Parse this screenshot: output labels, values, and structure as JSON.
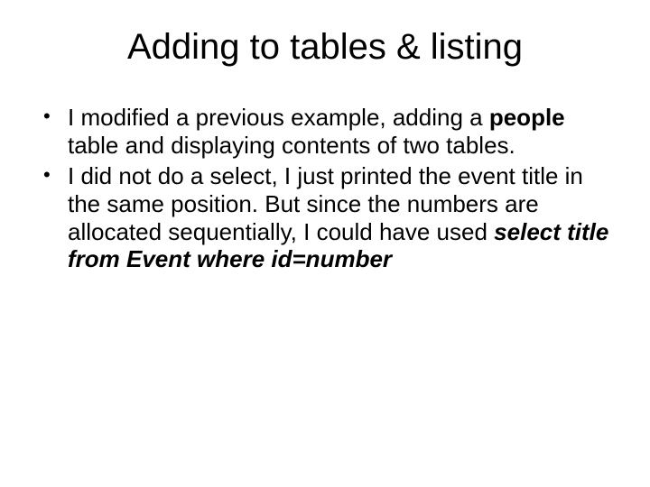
{
  "title": "Adding to tables & listing",
  "b1a": "I modified a previous example, adding a ",
  "b1b": "people",
  "b1c": " table and displaying contents of two tables.",
  "b2a": "I did not do a select, I just printed the event title in the same position.  But since the numbers are allocated sequentially, I could have used ",
  "b2b": "select title from Event where id=number"
}
